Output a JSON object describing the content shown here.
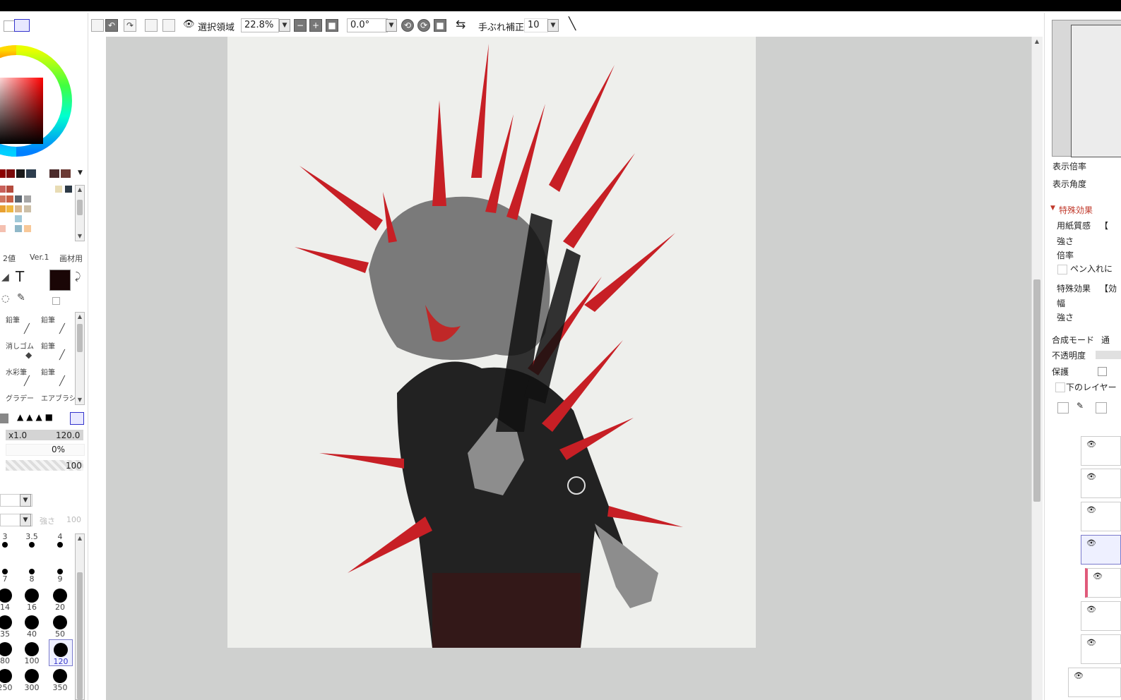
{
  "toolbar": {
    "selection_label": "選択領域",
    "zoom_value": "22.8%",
    "rotation_value": "0.0°",
    "stabilizer_label": "手ぶれ補正",
    "stabilizer_value": "10"
  },
  "left_panel": {
    "brush_labels": [
      "2値",
      "Ver.1",
      "画材用"
    ],
    "tools": [
      {
        "name": "鉛筆",
        "col": 0
      },
      {
        "name": "鉛筆",
        "col": 1
      },
      {
        "name": "消しゴム",
        "col": 0
      },
      {
        "name": "鉛筆",
        "col": 1
      },
      {
        "name": "水彩筆",
        "col": 0
      },
      {
        "name": "鉛筆",
        "col": 1
      },
      {
        "name": "グラデー",
        "col": 0
      },
      {
        "name": "エアブラシ",
        "col": 1
      }
    ],
    "size_mult": "x1.0",
    "size_value": "120.0",
    "min_size": "0%",
    "density": "100",
    "density_label": "強さ",
    "density_value": "100",
    "size_presets": [
      "3",
      "3.5",
      "4",
      "7",
      "8",
      "9",
      "14",
      "16",
      "20",
      "35",
      "40",
      "50",
      "80",
      "100",
      "120",
      "250",
      "300",
      "350"
    ],
    "selected_size": "120"
  },
  "right_panel": {
    "view_zoom_label": "表示倍率",
    "view_angle_label": "表示角度",
    "effects_header": "特殊効果",
    "paper_texture_label": "用紙質感",
    "paper_texture_value": "【",
    "strength_label": "強さ",
    "scale_label": "倍率",
    "pen_label": "ペン入れに",
    "effect_label": "特殊効果",
    "effect_value": "【効",
    "width_label": "幅",
    "strength2_label": "強さ",
    "blend_label": "合成モード",
    "blend_value": "通",
    "opacity_label": "不透明度",
    "protect_label": "保護",
    "below_layer_label": "下のレイヤー"
  }
}
